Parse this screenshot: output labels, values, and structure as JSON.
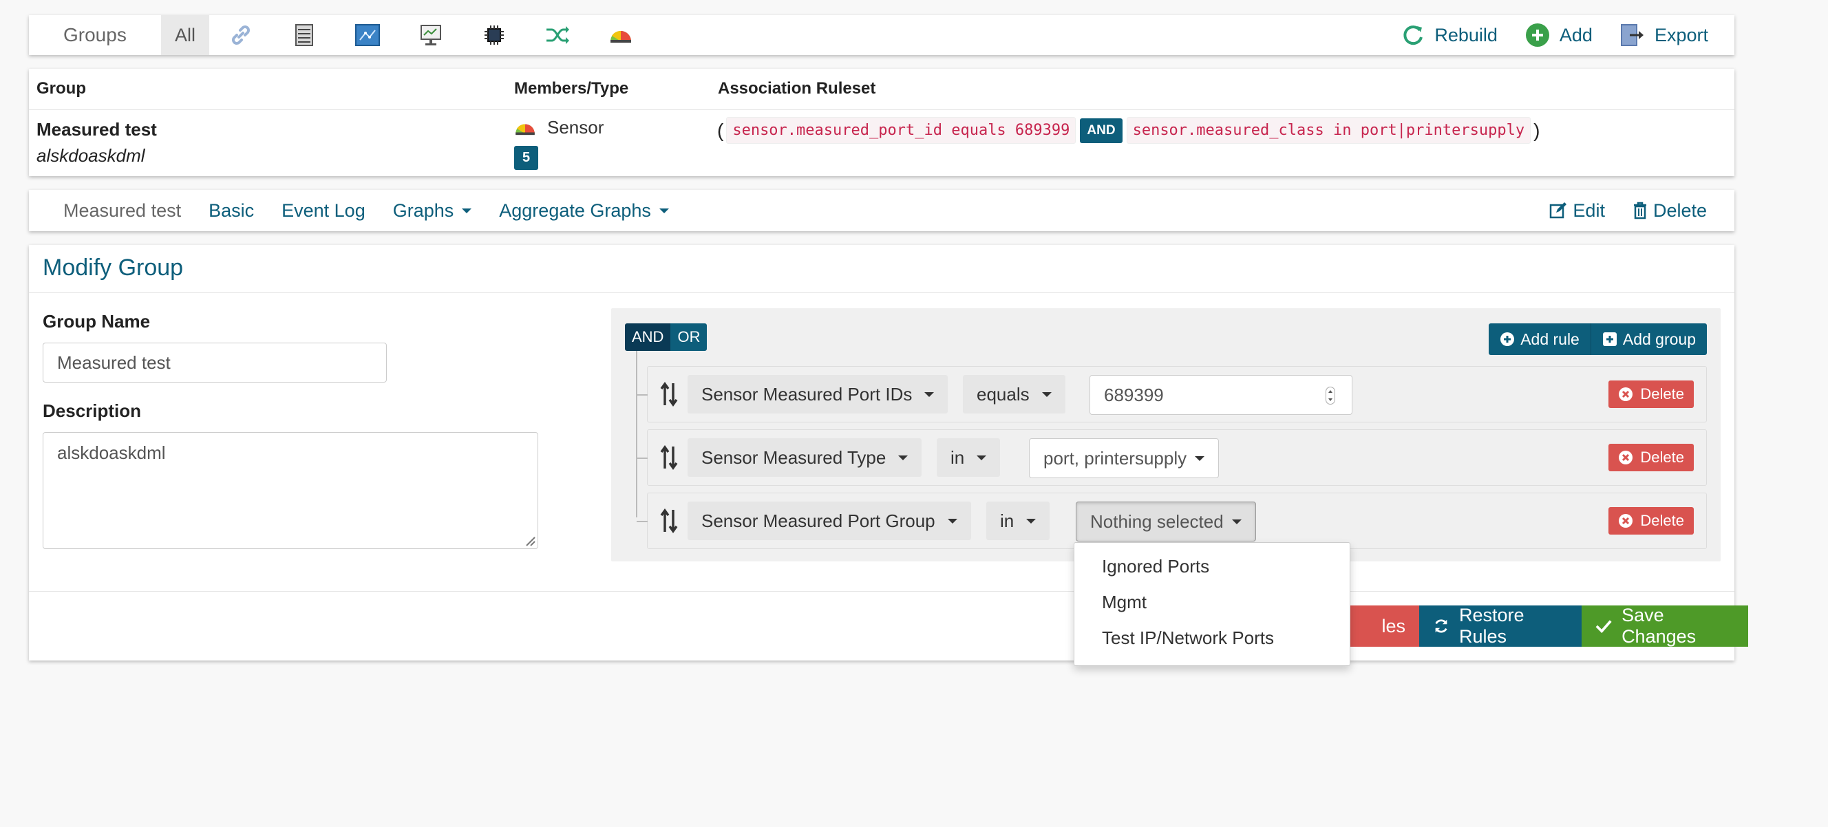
{
  "topnav": {
    "brand": "Groups",
    "tab_all": "All",
    "actions": {
      "rebuild": "Rebuild",
      "add": "Add",
      "export": "Export"
    }
  },
  "groups_table": {
    "headers": {
      "group": "Group",
      "members": "Members/Type",
      "ruleset": "Association Ruleset"
    },
    "row": {
      "name": "Measured test",
      "description": "alskdoaskdml",
      "member_type": "Sensor",
      "count": "5",
      "ruleset": {
        "open": "(",
        "rule1": "sensor.measured_port_id equals 689399",
        "op": "AND",
        "rule2": "sensor.measured_class in port|printersupply",
        "close": ")"
      }
    }
  },
  "subnav": {
    "title": "Measured test",
    "links": {
      "basic": "Basic",
      "event_log": "Event Log",
      "graphs": "Graphs",
      "aggregate": "Aggregate Graphs"
    },
    "edit": "Edit",
    "delete": "Delete"
  },
  "modify": {
    "title": "Modify Group",
    "name_label": "Group Name",
    "name_value": "Measured test",
    "desc_label": "Description",
    "desc_value": "alskdoaskdml"
  },
  "builder": {
    "and": "AND",
    "or": "OR",
    "add_rule": "Add rule",
    "add_group": "Add group",
    "delete": "Delete",
    "rules": [
      {
        "field": "Sensor Measured Port IDs",
        "operator": "equals",
        "value": "689399"
      },
      {
        "field": "Sensor Measured Type",
        "operator": "in",
        "value": "port, printersupply"
      },
      {
        "field": "Sensor Measured Port Group",
        "operator": "in",
        "value": "Nothing selected"
      }
    ]
  },
  "footer": {
    "partial_button": "les",
    "restore": "Restore Rules",
    "save": "Save Changes"
  },
  "dropdown": {
    "options": [
      "Ignored Ports",
      "Mgmt",
      "Test IP/Network Ports"
    ]
  },
  "colors": {
    "primary": "#0d5e7b",
    "danger": "#d9534f",
    "success": "#4e9a28",
    "code_text": "#c7254e"
  }
}
